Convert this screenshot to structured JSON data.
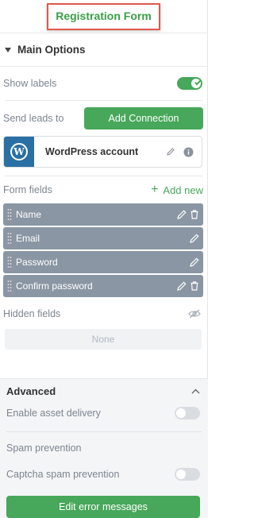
{
  "header": {
    "title": "Registration Form"
  },
  "main_options": {
    "label": "Main Options",
    "show_labels": {
      "label": "Show labels",
      "on": true
    },
    "send_leads": {
      "label": "Send leads to",
      "button": "Add Connection"
    },
    "connection": {
      "name": "WordPress account",
      "logo_letter": "W"
    },
    "form_fields": {
      "label": "Form fields",
      "add_label": "Add new",
      "fields": [
        {
          "name": "Name",
          "deletable": true
        },
        {
          "name": "Email",
          "deletable": false
        },
        {
          "name": "Password",
          "deletable": false
        },
        {
          "name": "Confirm password",
          "deletable": true
        }
      ]
    },
    "hidden_fields": {
      "label": "Hidden fields",
      "value": "None"
    }
  },
  "advanced": {
    "label": "Advanced",
    "asset_delivery": {
      "label": "Enable asset delivery",
      "on": false
    },
    "spam_heading": "Spam prevention",
    "captcha": {
      "label": "Captcha spam prevention",
      "on": false
    },
    "error_button": "Edit error messages"
  },
  "colors": {
    "accent": "#47a75a",
    "field_bg": "#8a96a3",
    "highlight": "#e05a4b",
    "wp": "#2a70a4"
  }
}
